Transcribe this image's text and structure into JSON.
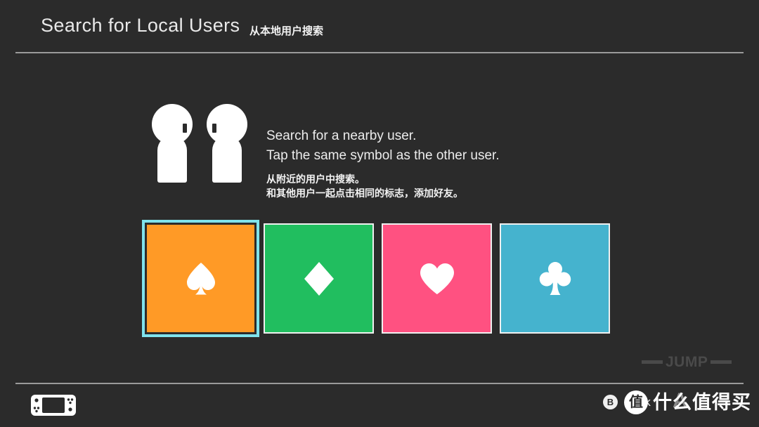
{
  "header": {
    "title": "Search for Local Users",
    "subtitle_zh": "从本地用户搜索"
  },
  "main": {
    "figures_icon": "two-users-icon",
    "instruction_line1": "Search for a nearby user.",
    "instruction_line2": "Tap the same symbol as the other user.",
    "instruction_zh_line1": "从附近的用户中搜索。",
    "instruction_zh_line2": "和其他用户一起点击相同的标志，添加好友。",
    "cards": [
      {
        "symbol": "spade",
        "icon": "spade-icon",
        "color": "#ff9a26",
        "selected": true
      },
      {
        "symbol": "diamond",
        "icon": "diamond-icon",
        "color": "#21be5f",
        "selected": false
      },
      {
        "symbol": "heart",
        "icon": "heart-icon",
        "color": "#ff5181",
        "selected": false
      },
      {
        "symbol": "club",
        "icon": "club-icon",
        "color": "#45b3ce",
        "selected": false
      }
    ],
    "selection_ring_color": "#7fe3ec"
  },
  "watermarks": {
    "jump_text": "JUMP",
    "site_badge": "值",
    "site_text": "什么值得买",
    "overlay_letter": "A"
  },
  "footer": {
    "console_icon": "nintendo-switch-icon",
    "back_button_glyph": "B",
    "back_label": "Back"
  }
}
